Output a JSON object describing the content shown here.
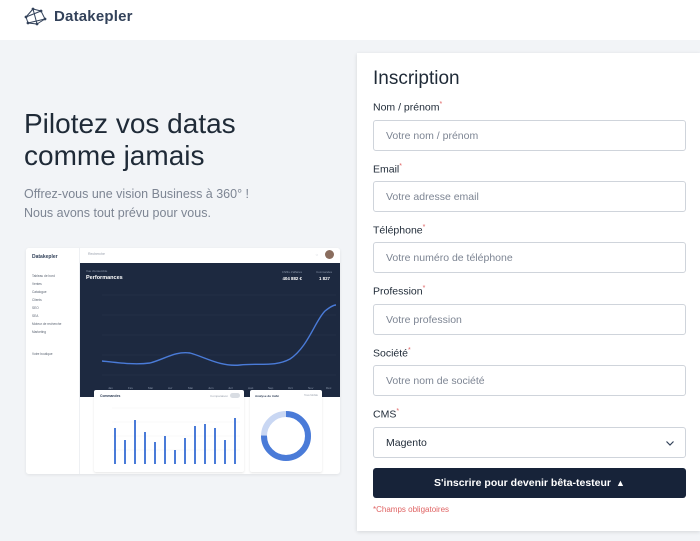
{
  "header": {
    "brand": "Datakepler"
  },
  "hero": {
    "title_line1": "Pilotez vos datas",
    "title_line2": "comme jamais",
    "subtitle_line1": "Offrez-vous une vision Business à 360° !",
    "subtitle_line2": "Nous avons tout prévu pour vous."
  },
  "mockup": {
    "brand": "Datakepler",
    "search": "Recherche",
    "sidebar_items": [
      "Tableau de bord",
      "Ventes",
      "Catalogue",
      "Clients",
      "SEO",
      "SEA",
      "Moteur de recherche",
      "Marketing",
      "Votre boutique"
    ],
    "panel_kicker": "Vue d'ensemble",
    "panel_title": "Performances",
    "kpi1_label": "Chiffre d'affaires",
    "kpi1_value": "404 882 €",
    "kpi2_label": "Commandes",
    "kpi2_value": "1 827",
    "card1_title": "Commandes",
    "card1_compare": "Comparaison",
    "card2_title": "Analyse du trafic",
    "card2_switch": "Tous  Mobile"
  },
  "form": {
    "title": "Inscription",
    "fields": [
      {
        "label": "Nom / prénom",
        "placeholder": "Votre nom / prénom"
      },
      {
        "label": "Email",
        "placeholder": "Votre adresse email"
      },
      {
        "label": "Téléphone",
        "placeholder": "Votre numéro de téléphone"
      },
      {
        "label": "Profession",
        "placeholder": "Votre profession"
      },
      {
        "label": "Société",
        "placeholder": "Votre nom de société"
      }
    ],
    "cms_label": "CMS",
    "cms_value": "Magento",
    "required_mark": "*",
    "submit_label": "S'inscrire pour devenir bêta-testeur",
    "submit_icon": "▲",
    "required_note": "*Champs obligatoires"
  },
  "colors": {
    "brand_dark": "#172339",
    "required": "#e06464",
    "chart_blue": "#4a7bd8"
  }
}
